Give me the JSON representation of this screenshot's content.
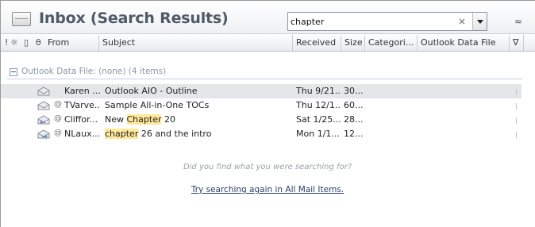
{
  "header": {
    "title": "Inbox (Search Results)",
    "search_value": "chapter",
    "clear_label": "×"
  },
  "columns": {
    "importance": "!",
    "reminder": "☼",
    "icon": "🗋",
    "attachment": "θ",
    "from": "From",
    "subject": "Subject",
    "received": "Received",
    "size": "Size",
    "categories": "Categori...",
    "data_file": "Outlook Data File",
    "flag": "∇"
  },
  "group": {
    "label": "Outlook Data File: (none) (4 items)"
  },
  "rows": [
    {
      "from": "Karen ...",
      "subject": "Outlook AIO - Outline",
      "received": "Thu 9/21...",
      "size": "30...",
      "attachment": false,
      "icon": "mail-read-icon"
    },
    {
      "from": "TVarve...",
      "subject": "Sample All-in-One TOCs",
      "received": "Thu 12/1...",
      "size": "60...",
      "attachment": true,
      "icon": "mail-read-icon"
    },
    {
      "from": "Cliffor...",
      "subject_pre": "New ",
      "subject_hl": "Chapter",
      "subject_post": " 20",
      "received": "Sat 1/25...",
      "size": "28...",
      "attachment": true,
      "icon": "mail-replied-icon"
    },
    {
      "from": "NLaux...",
      "subject_pre": "",
      "subject_hl": "chapter",
      "subject_post": " 26 and the intro",
      "received": "Mon 1/1...",
      "size": "12...",
      "attachment": true,
      "icon": "mail-forwarded-icon"
    }
  ],
  "empty_prompt": "Did you find what you were searching for?",
  "retry_link": "Try searching again in All Mail Items.",
  "colors": {
    "highlight": "#ffe89a",
    "group_text": "#8a96a6",
    "selected_row": "#e4e6e9"
  }
}
